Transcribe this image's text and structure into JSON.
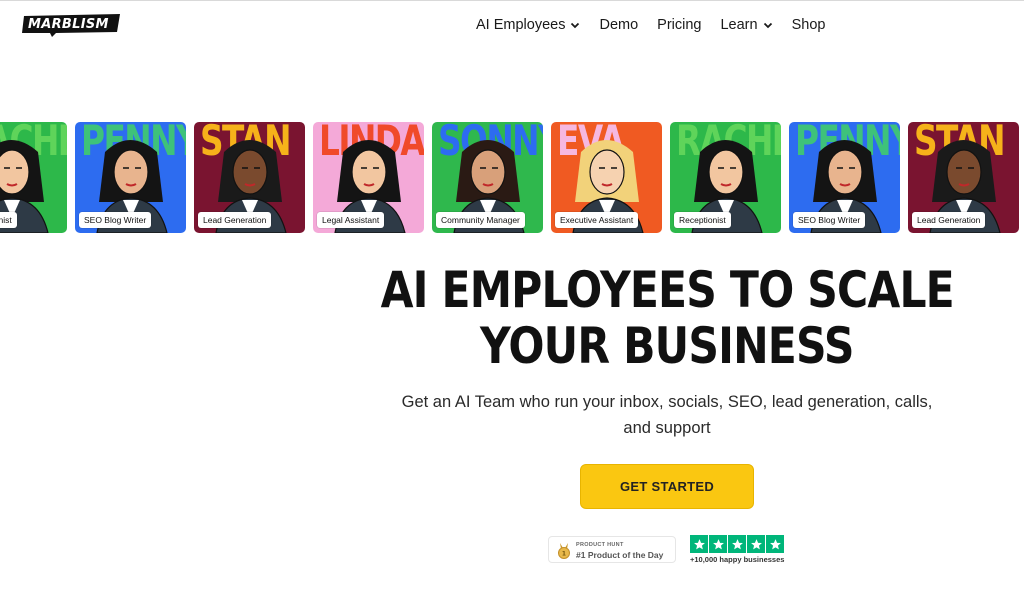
{
  "brand": {
    "logo_text": "MARBLISM"
  },
  "nav": {
    "items": [
      {
        "label": "AI Employees",
        "has_dropdown": true
      },
      {
        "label": "Demo",
        "has_dropdown": false
      },
      {
        "label": "Pricing",
        "has_dropdown": false
      },
      {
        "label": "Learn",
        "has_dropdown": true
      },
      {
        "label": "Shop",
        "has_dropdown": false
      }
    ]
  },
  "carousel": {
    "cards": [
      {
        "name": "RACHEL",
        "role": "Receptionist",
        "bg": "#2db84a",
        "name_color": "#5fd45a"
      },
      {
        "name": "PENNY",
        "role": "SEO Blog Writer",
        "bg": "#2d6cf0",
        "name_color": "#3ec27a"
      },
      {
        "name": "STAN",
        "role": "Lead Generation",
        "bg": "#7a1430",
        "name_color": "#f6b21a"
      },
      {
        "name": "LINDA",
        "role": "Legal Assistant",
        "bg": "#f4a9d8",
        "name_color": "#f04a2a"
      },
      {
        "name": "SONNY",
        "role": "Community Manager",
        "bg": "#2fb84d",
        "name_color": "#2d6cf0"
      },
      {
        "name": "EVA",
        "role": "Executive Assistant",
        "bg": "#f05a22",
        "name_color": "#f6b8e0"
      },
      {
        "name": "RACHEL",
        "role": "Receptionist",
        "bg": "#2db84a",
        "name_color": "#5fd45a"
      },
      {
        "name": "PENNY",
        "role": "SEO Blog Writer",
        "bg": "#2d6cf0",
        "name_color": "#3ec27a"
      },
      {
        "name": "STAN",
        "role": "Lead Generation",
        "bg": "#7a1430",
        "name_color": "#f6b21a"
      }
    ]
  },
  "hero": {
    "headline_line1": "AI EMPLOYEES TO SCALE",
    "headline_line2": "YOUR BUSINESS",
    "subtitle_line1": "Get an AI Team who run your inbox, socials, SEO, lead generation, calls,",
    "subtitle_line2": "and support",
    "cta_label": "GET STARTED"
  },
  "badges": {
    "product_hunt": {
      "small": "PRODUCT HUNT",
      "big": "#1 Product of the Day"
    },
    "trustpilot": {
      "count_text": "+10,000 happy businesses",
      "stars": 5
    }
  },
  "colors": {
    "accent": "#fac711",
    "trust_green": "#00b67a"
  },
  "icons": [
    "chevron-down-icon",
    "medal-icon",
    "star-icon"
  ]
}
